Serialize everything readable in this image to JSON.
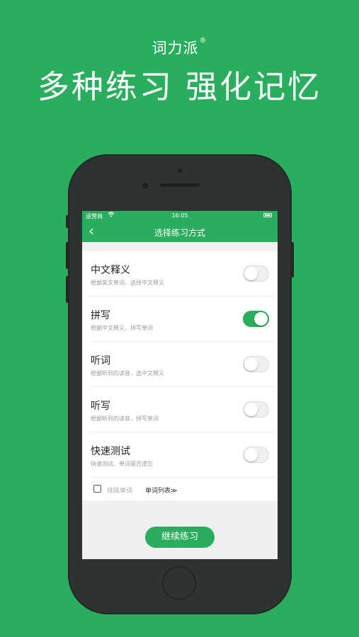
{
  "header": {
    "brand": "词力派",
    "brand_mark": "®",
    "slogan": "多种练习 强化记忆"
  },
  "statusbar": {
    "carrier": "运营商",
    "time": "16:05"
  },
  "navbar": {
    "back_glyph": "‹",
    "title": "选择练习方式"
  },
  "modes": [
    {
      "name": "中文释义",
      "desc": "根据英文单词，选择中文释义",
      "enabled": false
    },
    {
      "name": "拼写",
      "desc": "根据中文释义，拼写单词",
      "enabled": true
    },
    {
      "name": "听词",
      "desc": "根据听到的读音，选中文释义",
      "enabled": false
    },
    {
      "name": "听写",
      "desc": "根据听到的读音，拼写单词",
      "enabled": false
    },
    {
      "name": "快速测试",
      "desc": "快速测试，单词是否遗忘",
      "enabled": false
    }
  ],
  "options": {
    "exclude_label": "排除单词",
    "exclude_checked": false,
    "wordlist_link": "单词列表≫"
  },
  "footer": {
    "continue_label": "继续练习"
  },
  "colors": {
    "brand_green": "#28ae5c",
    "phone_body": "#2f3233"
  },
  "icons": {
    "back": "chevron-left-icon",
    "wifi": "wifi-icon",
    "battery": "battery-icon"
  }
}
